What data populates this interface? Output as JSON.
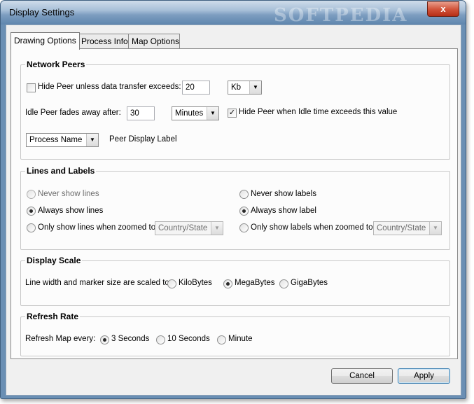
{
  "window": {
    "title": "Display Settings",
    "watermark": "SOFTPEDIA",
    "close_glyph": "x"
  },
  "tabs": [
    {
      "label": "Drawing Options",
      "active": true
    },
    {
      "label": "Process Info",
      "active": false
    },
    {
      "label": "Map Options",
      "active": false
    }
  ],
  "network_peers": {
    "title": "Network Peers",
    "hide_peer_label": "Hide Peer unless data transfer exceeds:",
    "hide_peer_checked": false,
    "transfer_value": "20",
    "transfer_unit": "Kb",
    "idle_label": "Idle Peer fades away after:",
    "idle_value": "30",
    "idle_unit": "Minutes",
    "hide_idle_label": "Hide Peer when Idle time exceeds this value",
    "hide_idle_checked": true,
    "display_label_select": "Process Name",
    "display_label_text": "Peer Display Label"
  },
  "lines_labels": {
    "title": "Lines and Labels",
    "never_lines": "Never show lines",
    "always_lines": "Always show lines",
    "zoom_lines": "Only show lines when zoomed to",
    "zoom_lines_select": "Country/State",
    "never_labels": "Never show labels",
    "always_labels": "Always show label",
    "zoom_labels": "Only show labels when zoomed to",
    "zoom_labels_select": "Country/State",
    "lines_selected": "always",
    "labels_selected": "always"
  },
  "display_scale": {
    "title": "Display Scale",
    "prompt": "Line width and marker size are scaled to:",
    "options": [
      "KiloBytes",
      "MegaBytes",
      "GigaBytes"
    ],
    "selected": "MegaBytes"
  },
  "refresh_rate": {
    "title": "Refresh Rate",
    "prompt": "Refresh Map every:",
    "options": [
      "3 Seconds",
      "10 Seconds",
      "Minute"
    ],
    "selected": "3 Seconds"
  },
  "buttons": {
    "cancel": "Cancel",
    "apply": "Apply"
  },
  "colors": {
    "accent": "#3c7fb1",
    "close": "#c8432a"
  }
}
